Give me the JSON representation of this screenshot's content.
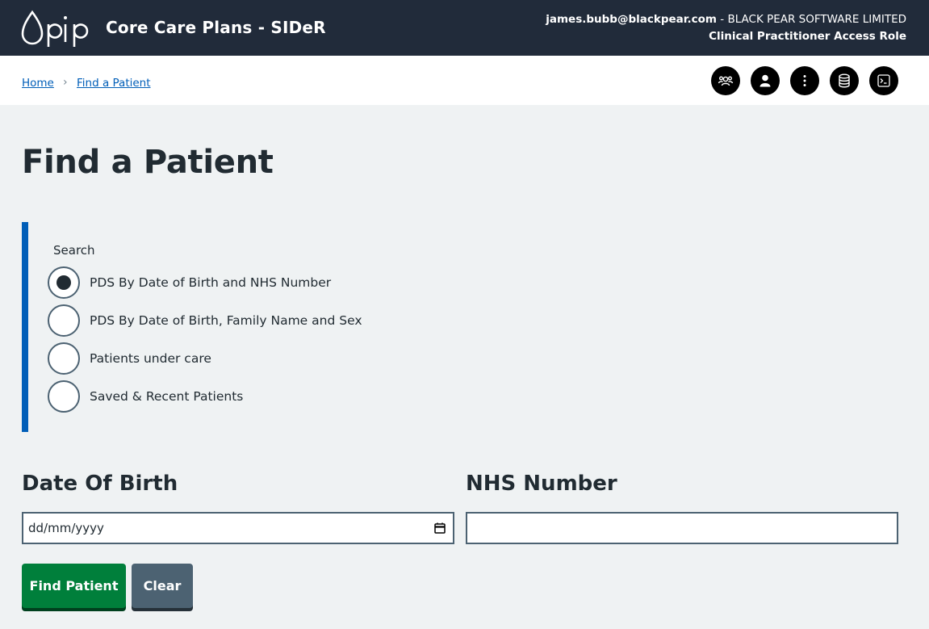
{
  "header": {
    "logo_text": "pip",
    "app_title": "Core Care Plans - SIDeR",
    "user_email": "james.bubb@blackpear.com",
    "org": " - BLACK PEAR SOFTWARE LIMITED",
    "role": "Clinical Practitioner Access Role"
  },
  "breadcrumb": {
    "home": "Home",
    "separator": "›",
    "current": "Find a Patient"
  },
  "toolbar_icons": [
    "team-icon",
    "user-icon",
    "more-vertical-icon",
    "database-icon",
    "terminal-icon"
  ],
  "page": {
    "title": "Find a Patient"
  },
  "search": {
    "legend": "Search",
    "options": [
      {
        "label": "PDS By Date of Birth and NHS Number",
        "checked": true
      },
      {
        "label": "PDS By Date of Birth, Family Name and Sex",
        "checked": false
      },
      {
        "label": "Patients under care",
        "checked": false
      },
      {
        "label": "Saved & Recent Patients",
        "checked": false
      }
    ]
  },
  "form": {
    "dob_label": "Date Of Birth",
    "dob_placeholder": "dd/mm/yyyy",
    "nhs_label": "NHS Number",
    "nhs_value": ""
  },
  "buttons": {
    "find": "Find Patient",
    "clear": "Clear"
  },
  "colors": {
    "header_bg": "#212b3a",
    "accent_blue": "#005eb8",
    "find_green": "#007f3b",
    "clear_grey": "#4c6272",
    "page_bg": "#eff2f3"
  }
}
